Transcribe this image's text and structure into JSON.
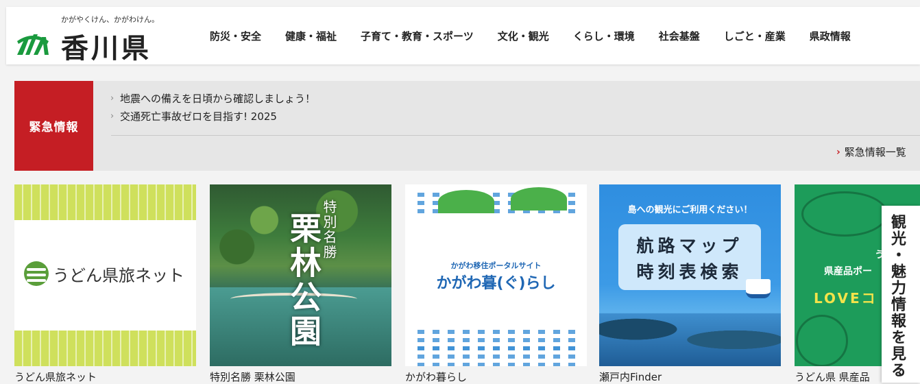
{
  "header": {
    "logo_tagline": "かがやくけん、かがわけん。",
    "logo_name": "香川県",
    "nav": [
      "防災・安全",
      "健康・福祉",
      "子育て・教育・スポーツ",
      "文化・観光",
      "くらし・環境",
      "社会基盤",
      "しごと・産業",
      "県政情報"
    ]
  },
  "emergency": {
    "label": "緊急情報",
    "items": [
      "地震への備えを日頃から確認しましょう！",
      "交通死亡事故ゼロを目指す! 2025"
    ],
    "more": "緊急情報一覧"
  },
  "banners": [
    {
      "logo_text": "うどん県旅ネット",
      "caption": "うどん県旅ネット"
    },
    {
      "title": "栗林公園",
      "subtitle": "特別名勝",
      "caption": "特別名勝 栗林公園"
    },
    {
      "portal": "かがわ移住ポータルサイト",
      "title": "かがわ暮(ぐ)らし",
      "caption": "かがわ暮らし"
    },
    {
      "top_text": "島への観光にご利用ください！",
      "line1": "航路マップ",
      "line2": "時刻表検索",
      "caption": "瀬戸内Finder"
    },
    {
      "line1": "うど",
      "line2": "県産品ポー",
      "line3": "LOVEコ",
      "caption": "うどん県 県産品"
    }
  ],
  "side_tab": {
    "label": "観光・魅力情報を見る",
    "chevron": "›"
  },
  "colors": {
    "emergency_red": "#c51e24",
    "logo_green": "#1a9a3e",
    "arrow_red": "#c51e24"
  }
}
